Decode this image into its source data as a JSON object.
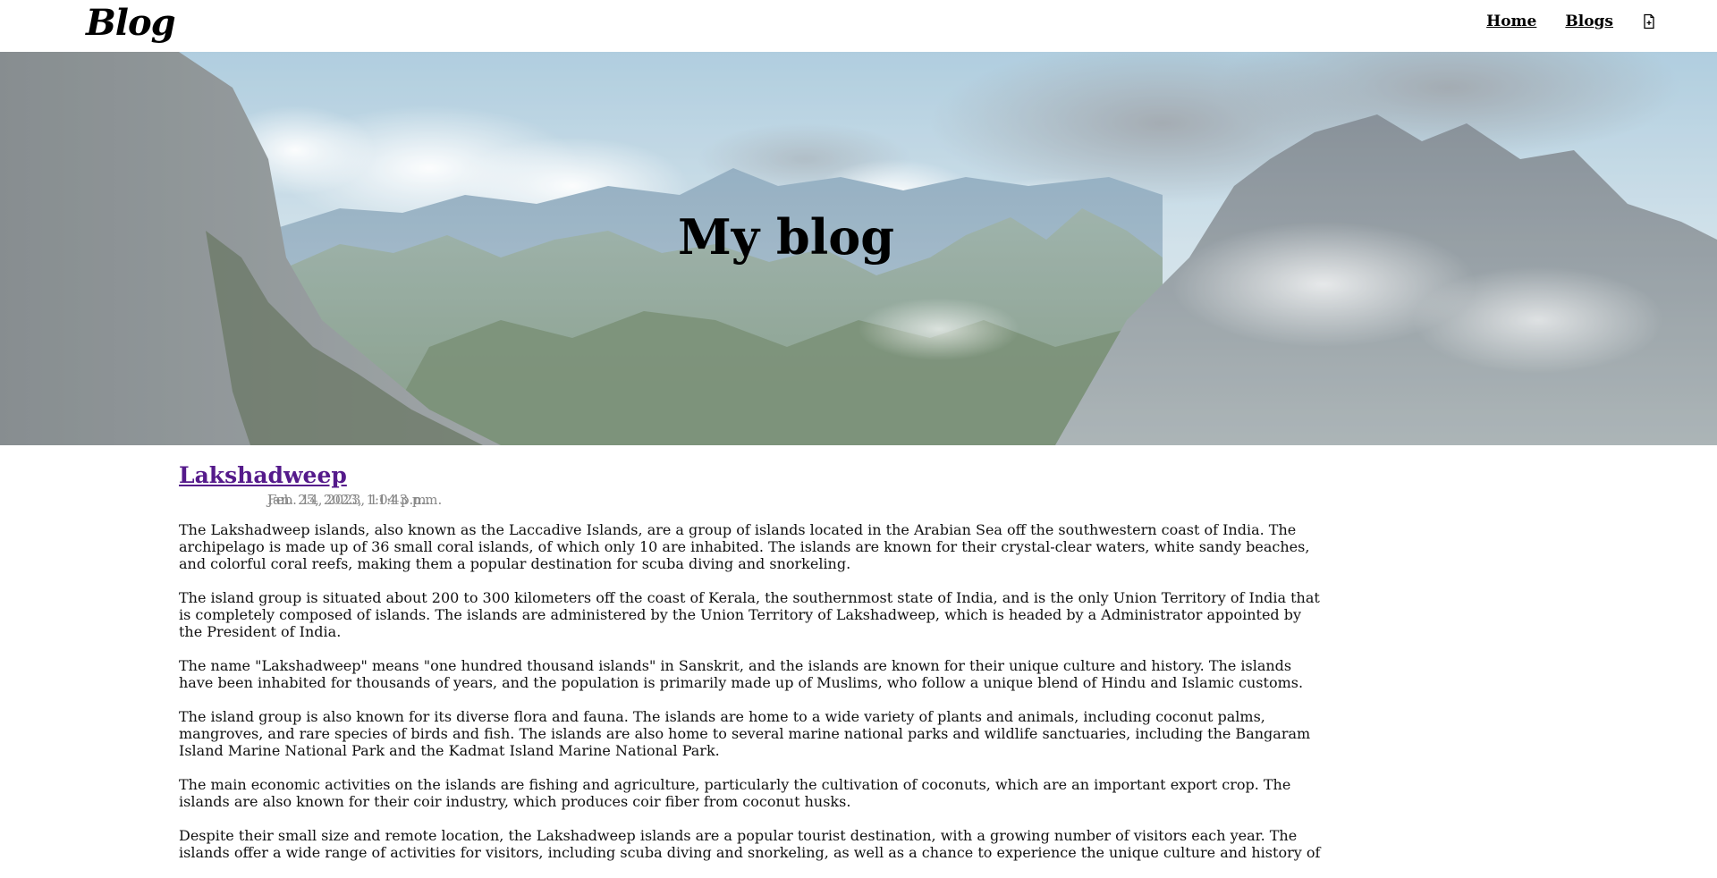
{
  "navbar": {
    "brand": "Blog",
    "links": [
      {
        "label": "Home"
      },
      {
        "label": "Blogs"
      }
    ],
    "icon": "document-icon"
  },
  "hero": {
    "title": "My blog",
    "background": "mountain-landscape-image"
  },
  "post": {
    "title": "Lakshadweep",
    "dates": [
      "Feb. 14, 2023, 11:43 p.m.",
      "Jan. 25, 2023, 1:04 p.m."
    ],
    "paragraphs": [
      "The Lakshadweep islands, also known as the Laccadive Islands, are a group of islands located in the Arabian Sea off the southwestern coast of India. The archipelago is made up of 36 small coral islands, of which only 10 are inhabited. The islands are known for their crystal-clear waters, white sandy beaches, and colorful coral reefs, making them a popular destination for scuba diving and snorkeling.",
      "The island group is situated about 200 to 300 kilometers off the coast of Kerala, the southernmost state of India, and is the only Union Territory of India that is completely composed of islands. The islands are administered by the Union Territory of Lakshadweep, which is headed by a Administrator appointed by the President of India.",
      "The name \"Lakshadweep\" means \"one hundred thousand islands\" in Sanskrit, and the islands are known for their unique culture and history. The islands have been inhabited for thousands of years, and the population is primarily made up of Muslims, who follow a unique blend of Hindu and Islamic customs.",
      "The island group is also known for its diverse flora and fauna. The islands are home to a wide variety of plants and animals, including coconut palms, mangroves, and rare species of birds and fish. The islands are also home to several marine national parks and wildlife sanctuaries, including the Bangaram Island Marine National Park and the Kadmat Island Marine National Park.",
      "The main economic activities on the islands are fishing and agriculture, particularly the cultivation of coconuts, which are an important export crop. The islands are also known for their coir industry, which produces coir fiber from coconut husks.",
      "Despite their small size and remote location, the Lakshadweep islands are a popular tourist destination, with a growing number of visitors each year. The islands offer a wide range of activities for visitors, including scuba diving and snorkeling, as well as a chance to experience the unique culture and history of"
    ]
  },
  "colors": {
    "link_visited": "#551a8b",
    "date_text": "#888888"
  }
}
